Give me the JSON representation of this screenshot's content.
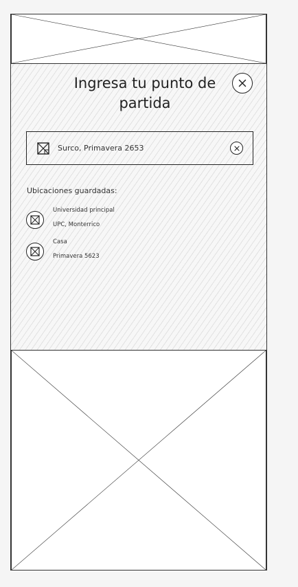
{
  "header": {
    "title": "Ingresa tu punto de partida"
  },
  "search": {
    "value": "Surco, Primavera 2653",
    "icon": "image-placeholder-icon",
    "clear_icon": "close-icon"
  },
  "saved_locations": {
    "label": "Ubicaciones guardadas:",
    "items": [
      {
        "name": "Universidad principal",
        "address": "UPC, Monterrico"
      },
      {
        "name": "Casa",
        "address": "Primavera 5623"
      }
    ]
  },
  "colors": {
    "stroke": "#222222",
    "panel_hatch": "#f7f7f7",
    "background": "#f5f5f5"
  }
}
